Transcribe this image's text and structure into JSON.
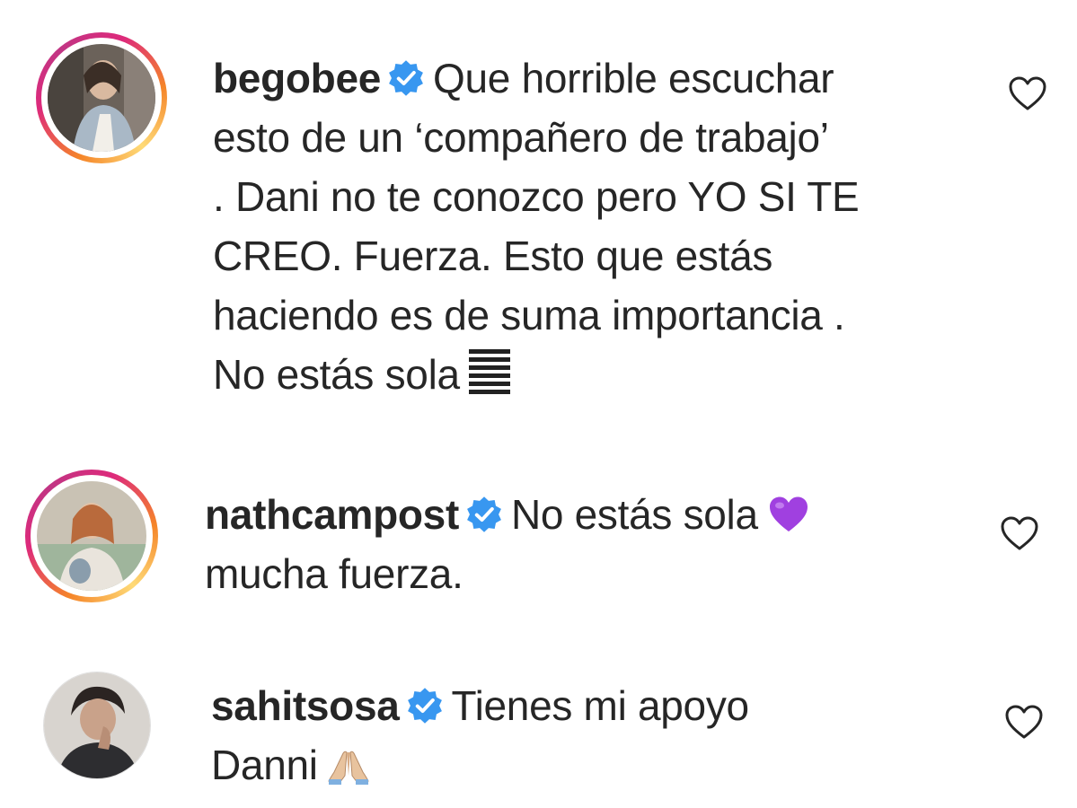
{
  "comments": [
    {
      "username": "begobee",
      "verified": true,
      "lines": [
        "Que horrible escuchar",
        "esto de un ‘compañero de trabajo’",
        ". Dani no te conozco pero YO SI TE",
        "CREO. Fuerza. Esto que estás",
        "haciendo es de suma importancia .",
        "No estás sola"
      ],
      "trailing_emoji": "flag-emoji",
      "has_story_ring": true
    },
    {
      "username": "nathcampost",
      "verified": true,
      "lines": [
        "No estás sola",
        "mucha fuerza."
      ],
      "inline_emoji": "purple-heart-emoji",
      "has_story_ring": true
    },
    {
      "username": "sahitsosa",
      "verified": true,
      "lines": [
        "Tienes mi apoyo",
        "Danni"
      ],
      "trailing_emoji": "folded-hands-emoji",
      "has_story_ring": false
    }
  ],
  "icons": {
    "like": "heart-outline-icon",
    "verified": "verified-badge-icon"
  },
  "colors": {
    "text": "#262626",
    "verified_blue": "#3897f0",
    "purple_heart": "#a040e0"
  }
}
